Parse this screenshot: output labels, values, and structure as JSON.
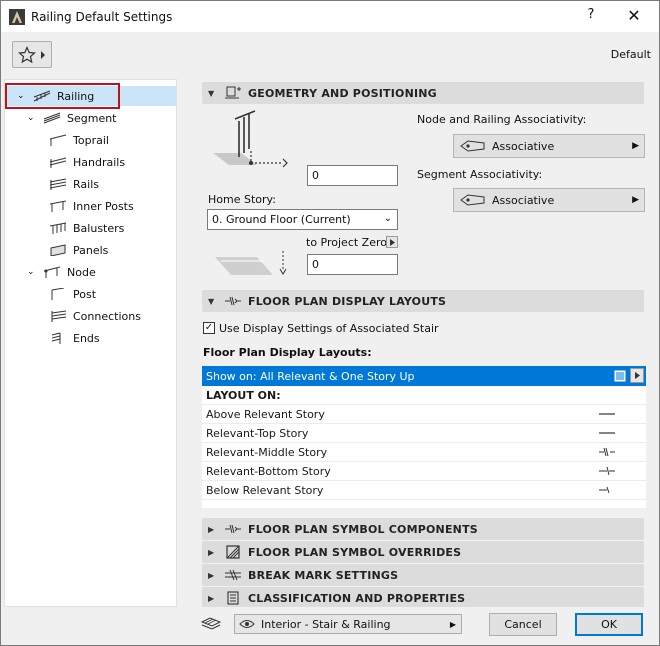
{
  "window": {
    "title": "Railing Default Settings",
    "help": "?",
    "close": "✕"
  },
  "toolbar": {
    "favorites_icon": "star-icon",
    "default_label": "Default"
  },
  "tree": {
    "items": [
      {
        "label": "Railing",
        "level": 0,
        "expanded": true,
        "selected": true
      },
      {
        "label": "Segment",
        "level": 1,
        "expanded": true
      },
      {
        "label": "Toprail",
        "level": 2
      },
      {
        "label": "Handrails",
        "level": 2
      },
      {
        "label": "Rails",
        "level": 2
      },
      {
        "label": "Inner Posts",
        "level": 2
      },
      {
        "label": "Balusters",
        "level": 2
      },
      {
        "label": "Panels",
        "level": 2
      },
      {
        "label": "Node",
        "level": 1,
        "expanded": true
      },
      {
        "label": "Post",
        "level": 2
      },
      {
        "label": "Connections",
        "level": 2
      },
      {
        "label": "Ends",
        "level": 2
      }
    ]
  },
  "geometry": {
    "header": "GEOMETRY AND POSITIONING",
    "height_value": "0",
    "home_story_label": "Home Story:",
    "home_story_value": "0. Ground Floor (Current)",
    "to_project_zero_label": "to Project Zero",
    "elevation_value": "0",
    "node_assoc_label": "Node and Railing Associativity:",
    "node_assoc_value": "Associative",
    "segment_assoc_label": "Segment Associativity:",
    "segment_assoc_value": "Associative"
  },
  "floor_plan": {
    "header": "FLOOR PLAN DISPLAY LAYOUTS",
    "use_display_label": "Use Display Settings of Associated Stair",
    "use_display_checked": true,
    "layouts_label": "Floor Plan Display Layouts:",
    "show_on": "Show on: All Relevant & One Story Up",
    "layout_on_label": "LAYOUT ON:",
    "rows": [
      {
        "label": "Above Relevant Story",
        "mark": "line"
      },
      {
        "label": "Relevant-Top Story",
        "mark": "line"
      },
      {
        "label": "Relevant-Middle Story",
        "mark": "break"
      },
      {
        "label": "Relevant-Bottom Story",
        "mark": "half"
      },
      {
        "label": "Below Relevant Story",
        "mark": "short"
      }
    ]
  },
  "collapsed_sections": [
    {
      "label": "FLOOR PLAN SYMBOL COMPONENTS"
    },
    {
      "label": "FLOOR PLAN SYMBOL OVERRIDES"
    },
    {
      "label": "BREAK MARK SETTINGS"
    },
    {
      "label": "CLASSIFICATION AND PROPERTIES"
    }
  ],
  "bottom": {
    "layer_value": "Interior - Stair & Railing",
    "cancel_label": "Cancel",
    "ok_label": "OK"
  },
  "colors": {
    "accent": "#0078d7",
    "highlight": "#c0111f",
    "tree_selected": "#cce4f7"
  }
}
